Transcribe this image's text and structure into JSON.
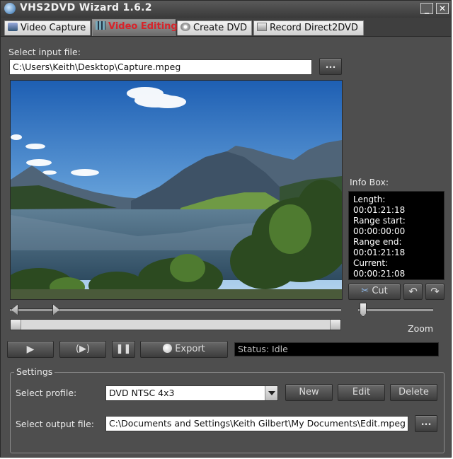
{
  "window": {
    "title": "VHS2DVD Wizard 1.6.2",
    "minimize_glyph": "_",
    "close_glyph": "✕"
  },
  "tabs": [
    {
      "label": "Video Capture",
      "icon": "video-capture-icon"
    },
    {
      "label": "Video Editing",
      "icon": "film-icon",
      "active": true
    },
    {
      "label": "Create DVD",
      "icon": "disc-icon"
    },
    {
      "label": "Record Direct2DVD",
      "icon": "record-icon"
    }
  ],
  "input": {
    "label": "Select input file:",
    "value": "C:\\Users\\Keith\\Desktop\\Capture.mpeg",
    "browse_label": "..."
  },
  "info_box": {
    "title": "Info Box:",
    "lines": [
      "Length:",
      "00:01:21:18",
      "Range start:",
      "00:00:00:00",
      "Range end:",
      "00:01:21:18",
      "Current:",
      "00:00:21:08"
    ]
  },
  "edit_buttons": {
    "cut_label": "Cut",
    "undo_icon": "undo-icon",
    "redo_icon": "redo-icon"
  },
  "zoom": {
    "label": "Zoom",
    "level": 0.0
  },
  "timeline": {
    "position": 0.13
  },
  "playback": {
    "play_icon": "play-icon",
    "play_range_icon": "play-range-icon",
    "pause_icon": "pause-icon",
    "export_label": "Export"
  },
  "status": {
    "text": "Status: Idle"
  },
  "settings": {
    "legend": "Settings",
    "profile_label": "Select profile:",
    "profile_value": "DVD NTSC 4x3",
    "new_label": "New",
    "edit_label": "Edit",
    "delete_label": "Delete",
    "output_label": "Select output file:",
    "output_value": "C:\\Documents and Settings\\Keith Gilbert\\My Documents\\Edit.mpeg",
    "output_browse_label": "..."
  }
}
